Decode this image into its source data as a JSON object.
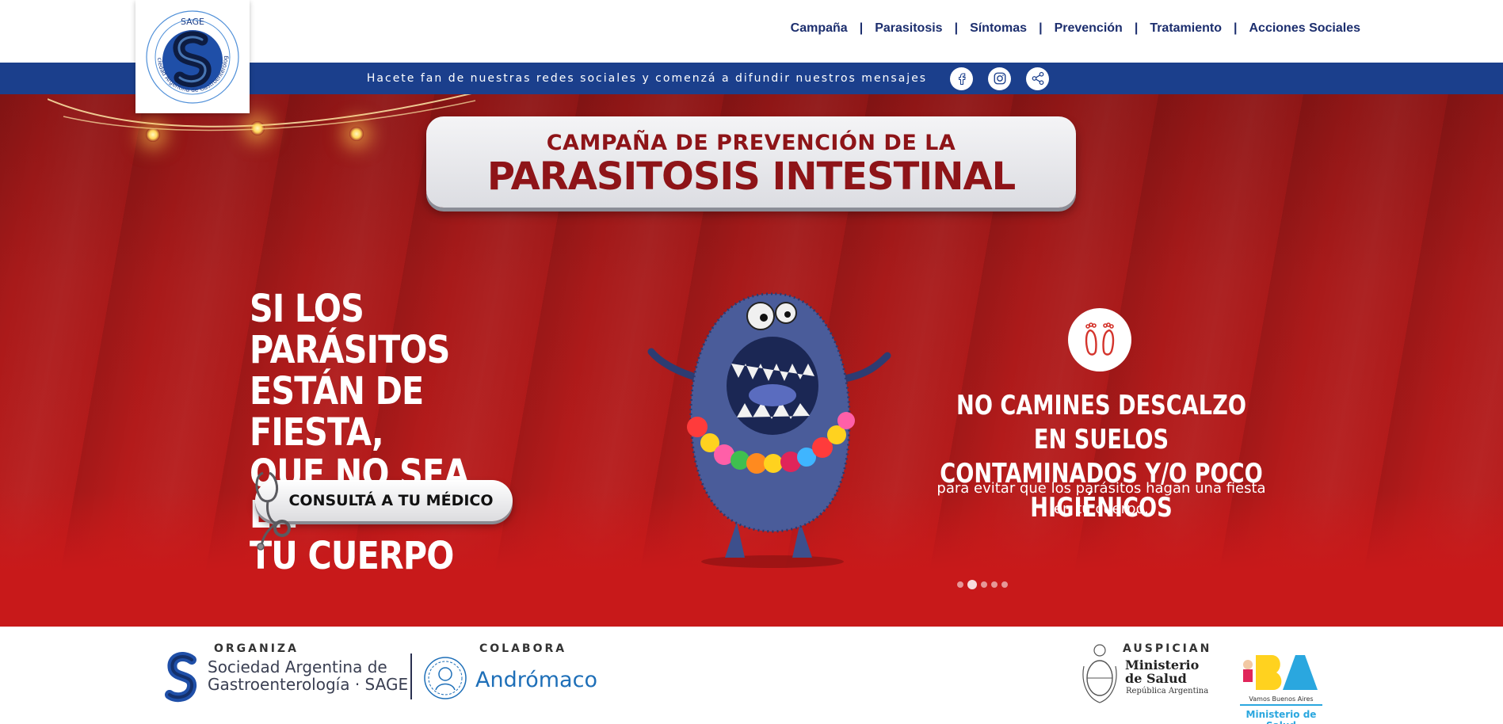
{
  "header": {
    "logo": {
      "acronym": "SAGE",
      "ring_text": "Sociedad Argentina de Gastroenterología"
    },
    "nav": [
      {
        "label": "Campaña"
      },
      {
        "label": "Parasitosis"
      },
      {
        "label": "Síntomas"
      },
      {
        "label": "Prevención"
      },
      {
        "label": "Tratamiento"
      },
      {
        "label": "Acciones Sociales"
      }
    ],
    "separator": "|"
  },
  "social_strip": {
    "text": "Hacete fan de nuestras redes sociales y comenzá a difundir nuestros mensajes",
    "icons": [
      "facebook-icon",
      "instagram-icon",
      "share-icon"
    ]
  },
  "hero": {
    "title_small": "CAMPAÑA DE PREVENCIÓN DE LA",
    "title_big": "PARASITOSIS INTESTINAL",
    "headline": [
      "SI LOS PARÁSITOS",
      "ESTÁN DE FIESTA,",
      "QUE NO SEA EN",
      "TU CUERPO"
    ],
    "cta_label": "CONSULTÁ A TU MÉDICO",
    "tip_icon": "footprints-icon",
    "tip_title": [
      "NO CAMINES DESCALZO EN SUELOS",
      "CONTAMINADOS Y/O POCO HIGIÉNICOS"
    ],
    "tip_text": "para evitar que los parásitos hagan una fiesta en tu cuerpo.",
    "slides_total": 5,
    "slide_active": 2
  },
  "footer": {
    "organiza_label": "ORGANIZA",
    "sage_name": [
      "Sociedad Argentina de",
      "Gastroenterología · SAGE"
    ],
    "colabora_label": "COLABORA",
    "andromaco_name": "Andrómaco",
    "auspician_label": "AUSPICIAN",
    "ministerio_name": [
      "Ministerio",
      "de Salud"
    ],
    "ministerio_sub": "República Argentina",
    "ba_sub": "Vamos Buenos Aires",
    "ba_ministerio": "Ministerio de Salud"
  },
  "colors": {
    "nav_text": "#1c2e6e",
    "strip_bg": "#1b3f8c",
    "hero_red": "#b51b1b",
    "title_red": "#8e1418",
    "andromaco_blue": "#1e6fb8"
  }
}
